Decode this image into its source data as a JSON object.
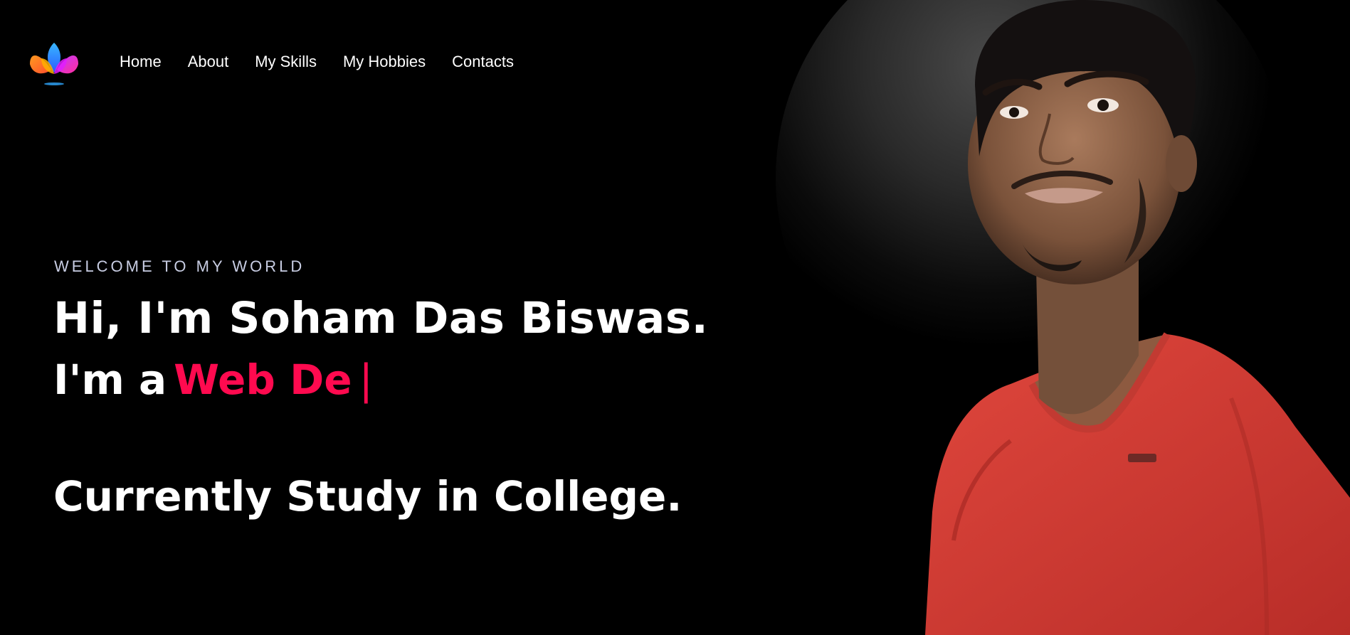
{
  "nav": {
    "logo_icon": "lotus-logo-icon",
    "items": [
      {
        "label": "Home"
      },
      {
        "label": "About"
      },
      {
        "label": "My Skills"
      },
      {
        "label": "My Hobbies"
      },
      {
        "label": "Contacts"
      }
    ]
  },
  "hero": {
    "welcome": "WELCOME TO MY WORLD",
    "headline": "Hi, I'm Soham Das Biswas.",
    "role_prefix": "I'm a",
    "role_typed": "Web De",
    "cursor": "|",
    "status": "Currently Study in College."
  },
  "colors": {
    "background": "#000000",
    "accent": "#ff0a4f",
    "welcome_text": "#c8cde3",
    "shirt": "#d23a33"
  },
  "portrait": {
    "icon": "profile-photo"
  }
}
